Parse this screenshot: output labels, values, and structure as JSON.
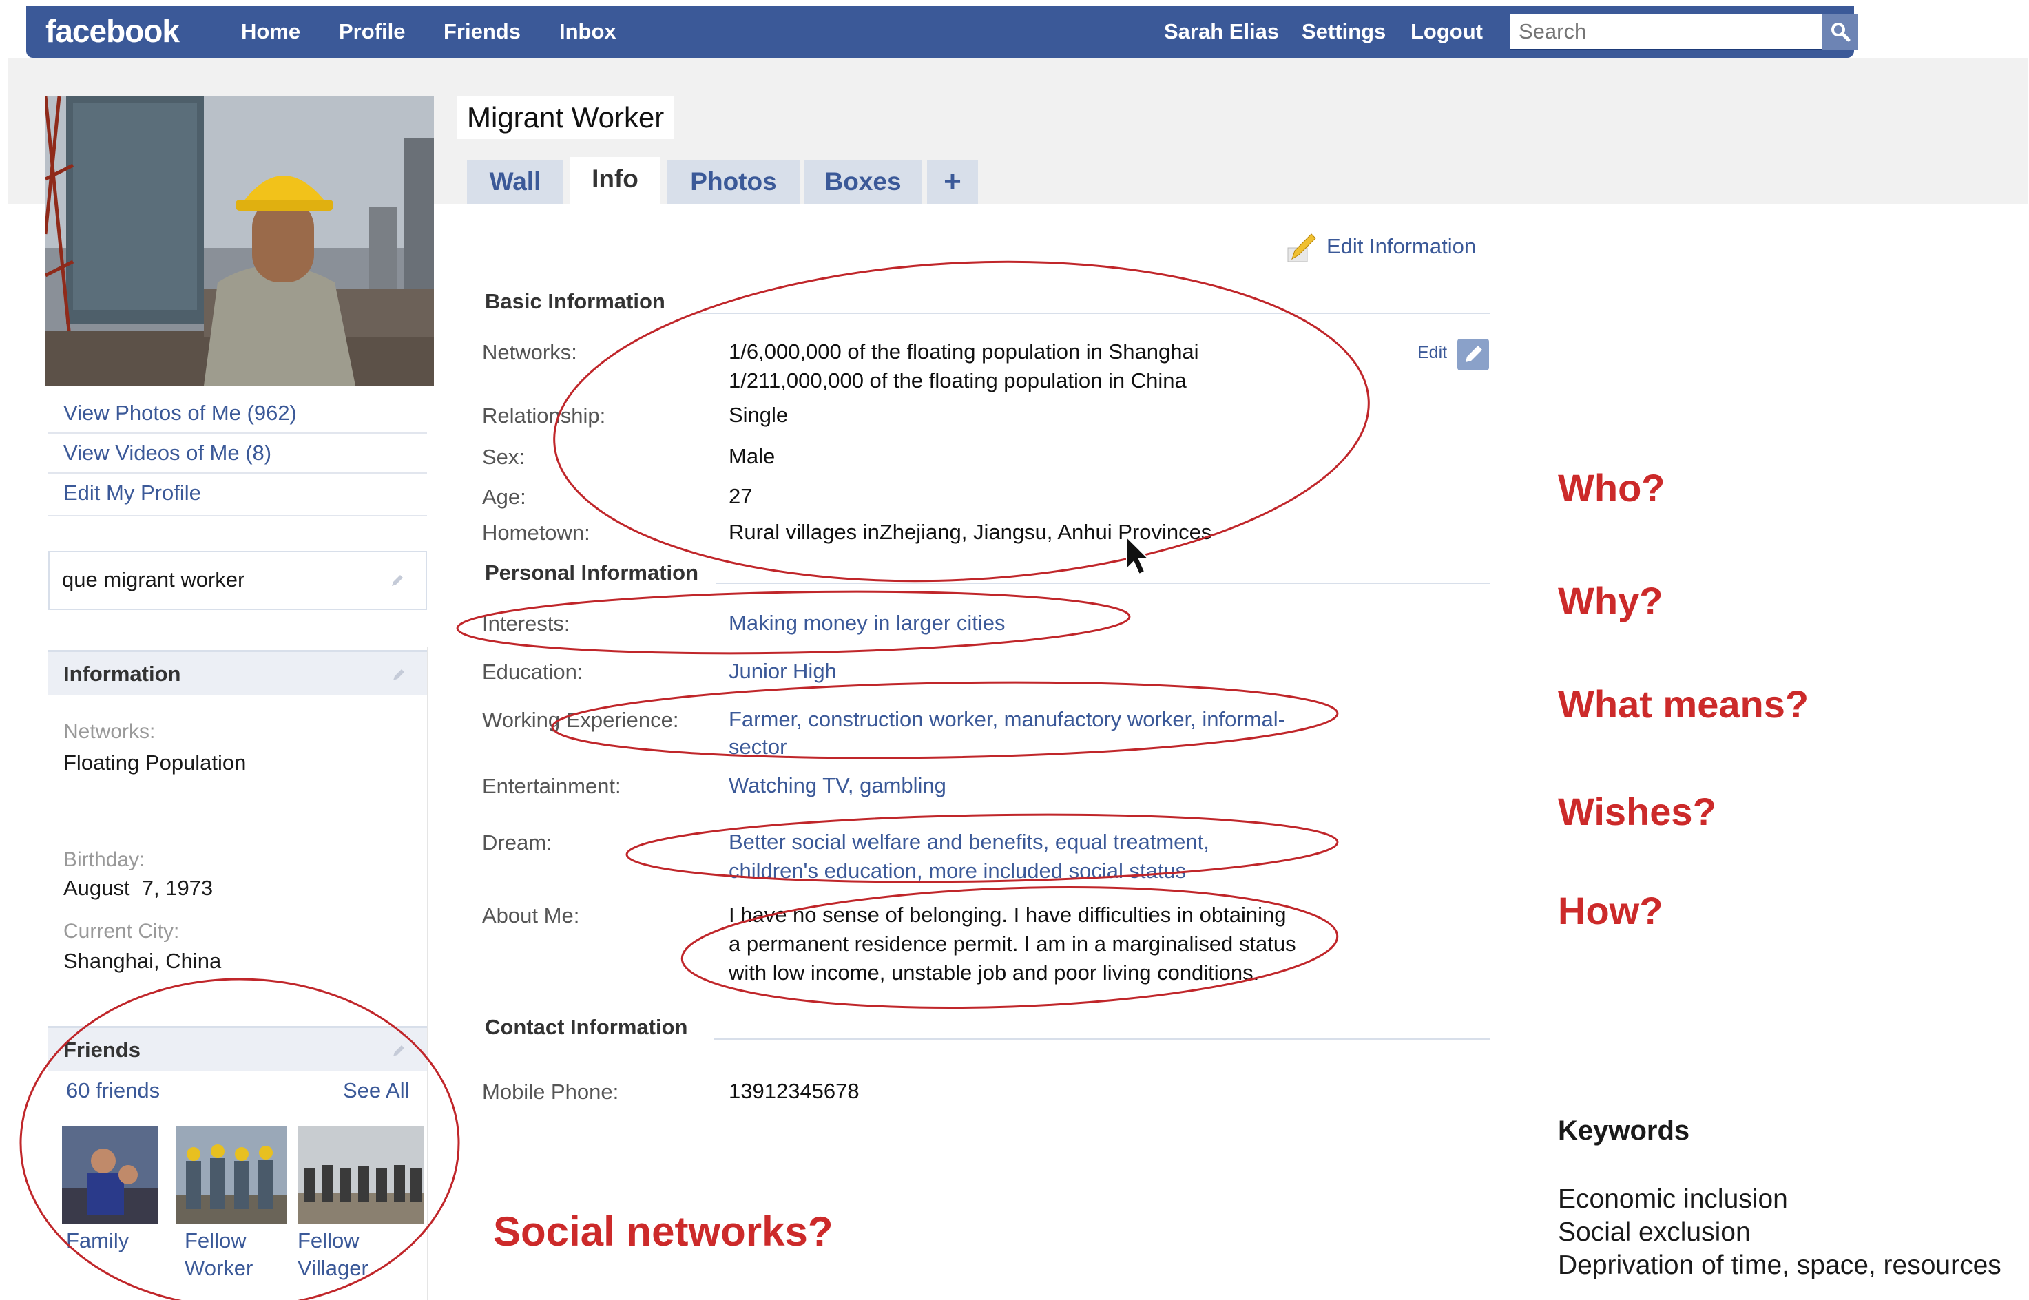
{
  "nav": {
    "logo": "facebook",
    "links": [
      "Home",
      "Profile",
      "Friends",
      "Inbox"
    ],
    "right_links": [
      "Sarah Elias",
      "Settings",
      "Logout"
    ],
    "search_placeholder": "Search"
  },
  "sidebar": {
    "links": [
      "View Photos of Me (962)",
      "View Videos of Me (8)",
      "Edit My Profile"
    ],
    "status": "que migrant worker",
    "info_title": "Information",
    "info": [
      {
        "label": "Networks:",
        "value": "Floating Population"
      },
      {
        "label": "Birthday:",
        "value": "August  7, 1973"
      },
      {
        "label": "Current City:",
        "value": "Shanghai, China"
      }
    ],
    "friends": {
      "title": "Friends",
      "count": "60 friends",
      "see_all": "See All",
      "items": [
        {
          "line1": "Family",
          "line2": ""
        },
        {
          "line1": "Fellow",
          "line2": "Worker"
        },
        {
          "line1": "Fellow",
          "line2": "Villager"
        }
      ]
    }
  },
  "profile": {
    "name": "Migrant Worker",
    "tabs": [
      "Wall",
      "Info",
      "Photos",
      "Boxes",
      "+"
    ],
    "active_tab": "Info",
    "edit_information": "Edit Information",
    "edit_small": "Edit",
    "basic_title": "Basic Information",
    "basic": {
      "networks_label": "Networks:",
      "networks_line1": "1/6,000,000 of the floating population in Shanghai",
      "networks_line2": "1/211,000,000 of the floating population in China",
      "relationship_label": "Relationship:",
      "relationship": "Single",
      "sex_label": "Sex:",
      "sex": "Male",
      "age_label": "Age:",
      "age": "27",
      "hometown_label": "Hometown:",
      "hometown": "Rural villages inZhejiang, Jiangsu, Anhui Provinces"
    },
    "personal_title": "Personal Information",
    "personal": {
      "interests_label": "Interests:",
      "interests": "Making money in larger cities",
      "education_label": "Education:",
      "education": "Junior High",
      "work_label": "Working Experience:",
      "work_line1": "Farmer, construction worker, manufactory worker, informal-",
      "work_line2": "sector",
      "entertainment_label": "Entertainment:",
      "entertainment": "Watching TV, gambling",
      "dream_label": "Dream:",
      "dream_line1": "Better social welfare and benefits, equal treatment,",
      "dream_line2": "children's education, more included social status",
      "about_label": "About Me:",
      "about_line1": "I have no sense of belonging. I have difficulties in obtaining",
      "about_line2": "a permanent residence permit. I am in a marginalised status",
      "about_line3": "with low income, unstable job and poor living conditions."
    },
    "contact_title": "Contact Information",
    "contact": {
      "mobile_label": "Mobile Phone:",
      "mobile": "13912345678"
    }
  },
  "annotations": {
    "questions": [
      "Who?",
      "Why?",
      "What means?",
      "Wishes?",
      "How?"
    ],
    "social": "Social networks?",
    "keywords_title": "Keywords",
    "keywords": [
      "Economic inclusion",
      "Social exclusion",
      "Deprivation of time, space, resources"
    ],
    "accent_color": "#cc2a2a"
  },
  "colors": {
    "facebook_blue": "#3b5998",
    "tab_bg": "#d8dfea"
  }
}
